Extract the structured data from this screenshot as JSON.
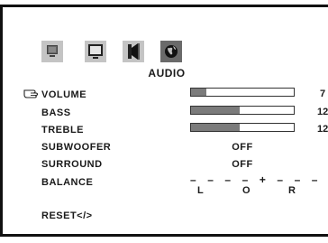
{
  "icons": [
    {
      "name": "picture-icon",
      "active": false
    },
    {
      "name": "monitor-icon",
      "active": false
    },
    {
      "name": "speaker-icon",
      "active": false
    },
    {
      "name": "globe-icon",
      "active": true
    }
  ],
  "menu": {
    "title": "AUDIO",
    "items": [
      {
        "label": "VOLUME",
        "level": 0.15,
        "value": "7",
        "selected": true
      },
      {
        "label": "BASS",
        "level": 0.47,
        "value": "12"
      },
      {
        "label": "TREBLE",
        "level": 0.47,
        "value": "12"
      },
      {
        "label": "SUBWOOFER",
        "value": "OFF"
      },
      {
        "label": "SURROUND",
        "value": "OFF"
      },
      {
        "label": "BALANCE",
        "scale": "– – – – + – – –",
        "left": "L",
        "center": "O",
        "right": "R"
      },
      {
        "label": "RESET</>"
      }
    ]
  },
  "colors": {
    "fill": "#7b7b7b",
    "icon_bg": "#c4c4c4",
    "icon_active_bg": "#6a6a6a"
  }
}
